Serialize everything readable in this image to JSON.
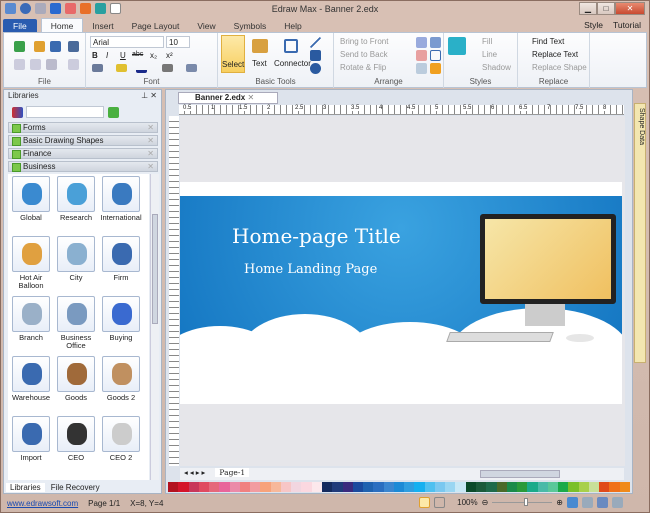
{
  "window": {
    "title": "Edraw Max - Banner 2.edx",
    "minimize": "▁",
    "maximize": "□",
    "close": "✕"
  },
  "tabs": [
    "File",
    "Home",
    "Insert",
    "Page Layout",
    "View",
    "Symbols",
    "Help"
  ],
  "tab_right": {
    "style": "Style",
    "tutorial": "Tutorial"
  },
  "ribbon": {
    "file_group": "File",
    "font": {
      "name": "Arial",
      "size": "10",
      "bold": "B",
      "italic": "I",
      "underline": "U",
      "strike": "abc",
      "sub": "x₂",
      "sup": "x²",
      "label": "Font"
    },
    "basic_tools": {
      "select": "Select",
      "text": "Text",
      "connector": "Connector",
      "label": "Basic Tools"
    },
    "arrange": {
      "bring_front": "Bring to Front",
      "send_back": "Send to Back",
      "rotate": "Rotate & Flip",
      "label": "Arrange"
    },
    "styles": {
      "fill": "Fill",
      "line": "Line",
      "shadow": "Shadow",
      "label": "Styles"
    },
    "replace": {
      "find": "Find Text",
      "replace_text": "Replace Text",
      "replace_shape": "Replace Shape",
      "label": "Replace"
    }
  },
  "libraries": {
    "title": "Libraries",
    "categories": [
      "Forms",
      "Basic Drawing Shapes",
      "Finance",
      "Business"
    ],
    "items": [
      "Global",
      "Research",
      "International",
      "Hot Air Balloon",
      "City",
      "Firm",
      "Branch",
      "Business Office",
      "Buying",
      "Warehouse",
      "Goods",
      "Goods 2",
      "Import",
      "CEO",
      "CEO 2"
    ],
    "bottom_tabs": [
      "Libraries",
      "File Recovery"
    ]
  },
  "document": {
    "tab": "Banner 2.edx",
    "ruler": [
      "0.5",
      "1",
      "1.5",
      "2",
      "2.5",
      "3",
      "3.5",
      "4",
      "4.5",
      "5",
      "5.5",
      "6",
      "6.5",
      "7",
      "7.5",
      "8"
    ],
    "title": "Home-page Title",
    "subtitle": "Home Landing Page",
    "page_tab": "Page-1",
    "shape_data": "Shape Data"
  },
  "palette": [
    "#b3121f",
    "#d4142a",
    "#c8375a",
    "#e04a60",
    "#e5677a",
    "#e8649a",
    "#eb8aa8",
    "#f08080",
    "#f29ca0",
    "#f7a27a",
    "#f7b89a",
    "#f7c6c6",
    "#f2d6e0",
    "#fbd8e0",
    "#fce8ec",
    "#142a5e",
    "#1f3a7a",
    "#3a2a7e",
    "#1a4a9e",
    "#1e62b0",
    "#2a6ec0",
    "#3a86d0",
    "#1c8ad6",
    "#2e9ee0",
    "#15b0f0",
    "#4ec0f0",
    "#7ac8f0",
    "#9ad6f2",
    "#c8e8f6",
    "#0a4a2a",
    "#1a5a3a",
    "#1e6a4a",
    "#4a6a2a",
    "#1a8a4a",
    "#2a9a3a",
    "#1aaa8a",
    "#4abaa8",
    "#5ac89a",
    "#1aaa4a",
    "#7ac02a",
    "#a8d04a",
    "#c8e098",
    "#e04a1a",
    "#f0701a",
    "#f08a1a"
  ],
  "status": {
    "link": "www.edrawsoft.com",
    "page": "Page 1/1",
    "coords": "X=8, Y=4",
    "zoom": "100%"
  }
}
